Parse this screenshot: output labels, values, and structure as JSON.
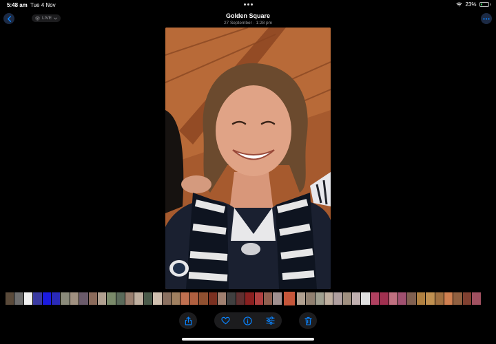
{
  "status": {
    "time": "5:48 am",
    "date": "Tue 4 Nov",
    "battery": "23%",
    "battery_level": 0.23
  },
  "header": {
    "title": "Golden Square",
    "subtitle": "27 September · 1:28 pm",
    "live_label": "LIVE"
  },
  "icons": {
    "back": "chevron-left-icon",
    "more": "ellipsis-icon",
    "share": "share-icon",
    "favorite": "heart-icon",
    "info": "info-icon",
    "adjust": "sliders-icon",
    "delete": "trash-icon"
  },
  "colors": {
    "accent": "#0a84ff",
    "background": "#000000",
    "battery_fill": "#34c759"
  },
  "filmstrip": {
    "thumbs": [
      "#5a4a3a",
      "#6e6e6e",
      "#f0f0f0",
      "#3a3aa0",
      "#1a1ae0",
      "#2a2ab8",
      "#8a8a7a",
      "#a09080",
      "#6a5a6a",
      "#8a6a5a",
      "#b0a090",
      "#7a8a6a",
      "#5a6a5a",
      "#9a8070",
      "#c0b0a0",
      "#4a5a4a",
      "#d0c0b0",
      "#8a7060",
      "#a08060",
      "#c07050",
      "#b06040",
      "#905030",
      "#7a3020",
      "#a08070",
      "#404040",
      "#603030",
      "#8a2020",
      "#b04040",
      "#906050",
      "#a09090",
      "#b0a090",
      "#908070",
      "#a0a090",
      "#c0b0a0",
      "#b0a0a0",
      "#a09080",
      "#c0b0b0",
      "#e0e0e0",
      "#b04060",
      "#a03050",
      "#c07080",
      "#a05070",
      "#806050",
      "#b08040",
      "#c09050",
      "#a07040",
      "#d08050",
      "#906040",
      "#804030",
      "#a05060"
    ],
    "current_index": 30,
    "current_color": "#c5563a"
  }
}
